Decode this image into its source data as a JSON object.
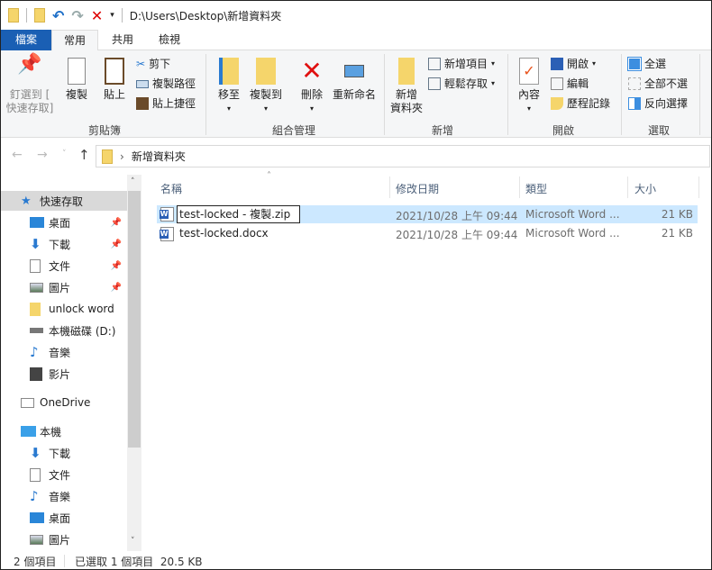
{
  "titlebar": {
    "path": "D:\\Users\\Desktop\\新增資料夾",
    "icons": [
      "folder-icon",
      "folder-icon",
      "undo-icon",
      "redo-icon",
      "delete-x-icon",
      "dropdown-arrow-icon"
    ]
  },
  "tabs": [
    {
      "label": "檔案",
      "active": false,
      "file": true
    },
    {
      "label": "常用",
      "active": true
    },
    {
      "label": "共用"
    },
    {
      "label": "檢視"
    }
  ],
  "ribbon": {
    "clipboard": {
      "label": "剪貼簿",
      "pin": "釘選到 [快速存取]",
      "pin_line1": "釘選到 [",
      "pin_line2": "快速存取]",
      "copy": "複製",
      "paste": "貼上",
      "cut": "剪下",
      "copy_path": "複製路徑",
      "paste_shortcut": "貼上捷徑"
    },
    "organize": {
      "label": "組合管理",
      "move_to": "移至",
      "copy_to": "複製到",
      "delete": "刪除",
      "rename": "重新命名"
    },
    "new": {
      "label": "新增",
      "new_folder_line1": "新增",
      "new_folder_line2": "資料夾",
      "new_item": "新增項目",
      "easy_access": "輕鬆存取"
    },
    "open": {
      "label": "開啟",
      "properties": "內容",
      "open": "開啟",
      "edit": "編輯",
      "history": "歷程記錄"
    },
    "select": {
      "label": "選取",
      "select_all": "全選",
      "select_none": "全部不選",
      "invert": "反向選擇"
    }
  },
  "address": {
    "crumb": "新增資料夾"
  },
  "nav": {
    "items": [
      {
        "label": "快速存取",
        "icon": "star-icon",
        "selected": true
      },
      {
        "label": "桌面",
        "icon": "desktop-icon",
        "pinned": true
      },
      {
        "label": "下載",
        "icon": "download-icon",
        "pinned": true
      },
      {
        "label": "文件",
        "icon": "documents-icon",
        "pinned": true
      },
      {
        "label": "圖片",
        "icon": "pictures-icon",
        "pinned": true
      },
      {
        "label": "unlock word",
        "icon": "folder-icon"
      },
      {
        "label": "本機磁碟 (D:)",
        "icon": "drive-icon"
      },
      {
        "label": "音樂",
        "icon": "music-icon"
      },
      {
        "label": "影片",
        "icon": "video-icon"
      },
      {
        "label": "OneDrive",
        "icon": "onedrive-icon"
      },
      {
        "label": "本機",
        "icon": "computer-icon"
      },
      {
        "label": "下載",
        "icon": "download-icon"
      },
      {
        "label": "文件",
        "icon": "documents-icon"
      },
      {
        "label": "音樂",
        "icon": "music-icon"
      },
      {
        "label": "桌面",
        "icon": "desktop-icon"
      },
      {
        "label": "圖片",
        "icon": "pictures-icon"
      }
    ]
  },
  "list": {
    "columns": [
      "名稱",
      "修改日期",
      "類型",
      "大小"
    ],
    "rows": [
      {
        "name": "test-locked - 複製.zip",
        "date": "2021/10/28 上午 09:44",
        "type": "Microsoft Word ...",
        "size": "21 KB",
        "selected": true,
        "renaming": true
      },
      {
        "name": "test-locked.docx",
        "date": "2021/10/28 上午 09:44",
        "type": "Microsoft Word ...",
        "size": "21 KB"
      }
    ]
  },
  "status": {
    "count": "2 個項目",
    "selected": "已選取 1 個項目  20.5 KB"
  },
  "colors": {
    "accent": "#1979ca",
    "selection": "#cce8ff",
    "file_tab": "#1a5fb4"
  }
}
